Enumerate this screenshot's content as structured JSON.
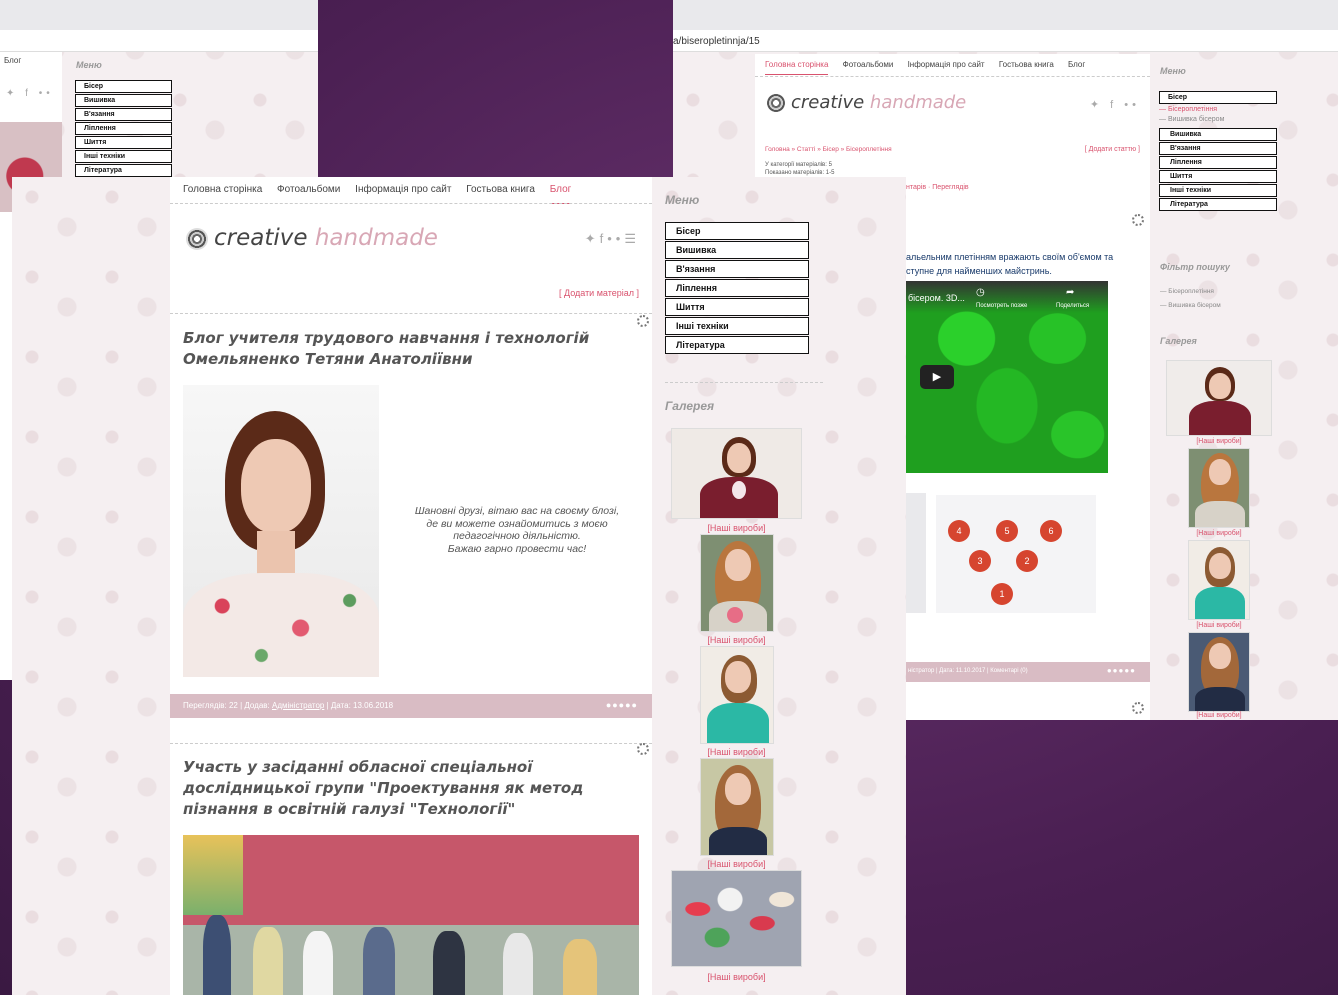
{
  "back_left": {
    "nav_active": "Блог",
    "menu_title": "Меню",
    "menu_items": [
      "Бісер",
      "Вишивка",
      "В'язання",
      "Ліплення",
      "Шиття",
      "Інші техніки",
      "Література"
    ]
  },
  "back_right": {
    "url": "a/biseropletinnja/15",
    "nav": [
      "Головна сторінка",
      "Фотоальбоми",
      "Інформація про сайт",
      "Гостьова книга",
      "Блог"
    ],
    "logo_word1": "creative",
    "logo_word2": "handmade",
    "breadcrumb": "Головна » Статті » Бісер » Бісероплетіння",
    "add_article": "[ Додати статтю ]",
    "category_count": "У категорії матеріалів: 5",
    "shown_materials": "Показано матеріалів: 1-5",
    "comments_views": "нтарів · Переглядів",
    "article_text_1": "альельним плетінням вражають своїм об'ємом та",
    "article_text_2": "ступне для найменших майстринь.",
    "video_title": "бісером. 3D...",
    "video_watch_later": "Посмотреть позже",
    "video_share": "Поделиться",
    "diagram_numbers": [
      "4",
      "5",
      "6",
      "3",
      "2",
      "1"
    ],
    "footer_stats": "ністратор | Дата: 11.10.2017 | Коментарі (0)",
    "menu_title": "Меню",
    "menu_active": "Бісер",
    "submenu": [
      "— Бісероплетіння",
      "— Вишивка бісером"
    ],
    "menu_items": [
      "Вишивка",
      "В'язання",
      "Ліплення",
      "Шиття",
      "Інші техніки",
      "Література"
    ],
    "filter_title": "Фільтр пошуку",
    "filter_items": [
      "— Бісероплетіння",
      "— Вишивка бісером"
    ],
    "gallery_title": "Галерея",
    "gallery_caption": "[Наші вироби]"
  },
  "front": {
    "nav": [
      "Головна сторінка",
      "Фотоальбоми",
      "Інформація про сайт",
      "Гостьова книга",
      "Блог"
    ],
    "logo_word1": "creative",
    "logo_word2": "handmade",
    "add_material": "[ Додати матеріал ]",
    "post1_title": "Блог учителя трудового навчання і технологій Омельяненко Тетяни Анатоліївни",
    "greeting_lines": [
      "Шановні друзі, вітаю вас на своєму блозі,",
      "де ви можете ознайомитись з моєю",
      "педагогічною діяльністю.",
      "Бажаю гарно провести час!"
    ],
    "stats_prefix": "Переглядів: 22 | Додав: ",
    "stats_author": "Адміністратор",
    "stats_suffix": " | Дата: 13.06.2018",
    "post2_title": "Участь у засіданні обласної спеціальної дослідницької групи \"Проектування як метод пізнання в освітній галузі \"Технології\"",
    "menu_title": "Меню",
    "menu_items": [
      "Бісер",
      "Вишивка",
      "В'язання",
      "Ліплення",
      "Шиття",
      "Інші техніки",
      "Література"
    ],
    "gallery_title": "Галерея",
    "gallery_caption": "[Наші вироби]"
  },
  "colors": {
    "accent": "#d9536e",
    "background": "#4a1f52",
    "stats_bar": "#d9bcc4"
  }
}
